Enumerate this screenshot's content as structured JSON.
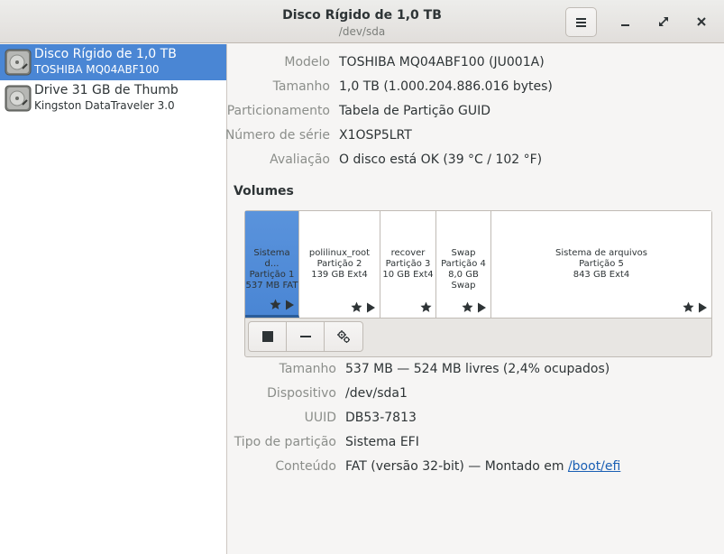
{
  "window": {
    "title": "Disco Rígido de 1,0 TB",
    "subtitle": "/dev/sda"
  },
  "sidebar": {
    "drives": [
      {
        "name": "Disco Rígido de 1,0 TB",
        "model": "TOSHIBA MQ04ABF100",
        "selected": true
      },
      {
        "name": "Drive 31 GB de Thumb",
        "model": "Kingston DataTraveler 3.0",
        "selected": false
      }
    ]
  },
  "drive_info": {
    "model_label": "Modelo",
    "model_value": "TOSHIBA MQ04ABF100 (JU001A)",
    "size_label": "Tamanho",
    "size_value": "1,0 TB (1.000.204.886.016 bytes)",
    "partitioning_label": "Particionamento",
    "partitioning_value": "Tabela de Partição GUID",
    "serial_label": "Número de série",
    "serial_value": "X1OSP5LRT",
    "assessment_label": "Avaliação",
    "assessment_value": "O disco está OK (39 °C / 102 °F)"
  },
  "volumes": {
    "heading": "Volumes",
    "segments": [
      {
        "name": "Sistema d...",
        "partition": "Partição 1",
        "size": "537 MB FAT",
        "selected": true,
        "icons": [
          "star",
          "play"
        ]
      },
      {
        "name": "polilinux_root",
        "partition": "Partição 2",
        "size": "139 GB Ext4",
        "selected": false,
        "icons": [
          "star",
          "play"
        ]
      },
      {
        "name": "recover",
        "partition": "Partição 3",
        "size": "10 GB Ext4",
        "selected": false,
        "icons": [
          "star"
        ]
      },
      {
        "name": "Swap",
        "partition": "Partição 4",
        "size": "8,0 GB Swap",
        "selected": false,
        "icons": [
          "star",
          "play"
        ]
      },
      {
        "name": "Sistema de arquivos",
        "partition": "Partição 5",
        "size": "843 GB Ext4",
        "selected": false,
        "icons": [
          "star",
          "play"
        ]
      }
    ],
    "toolbar": [
      "stop-icon",
      "minus-icon",
      "gears-icon"
    ]
  },
  "volume_info": {
    "size_label": "Tamanho",
    "size_value": "537 MB — 524 MB livres (2,4% ocupados)",
    "device_label": "Dispositivo",
    "device_value": "/dev/sda1",
    "uuid_label": "UUID",
    "uuid_value": "DB53-7813",
    "ptype_label": "Tipo de partição",
    "ptype_value": "Sistema EFI",
    "content_label": "Conteúdo",
    "content_value": "FAT (versão 32-bit) — Montado em ",
    "content_link": "/boot/efi"
  },
  "colors": {
    "selection": "#4a86d4",
    "link": "#1a5fb4",
    "label": "#8b8e8a"
  }
}
